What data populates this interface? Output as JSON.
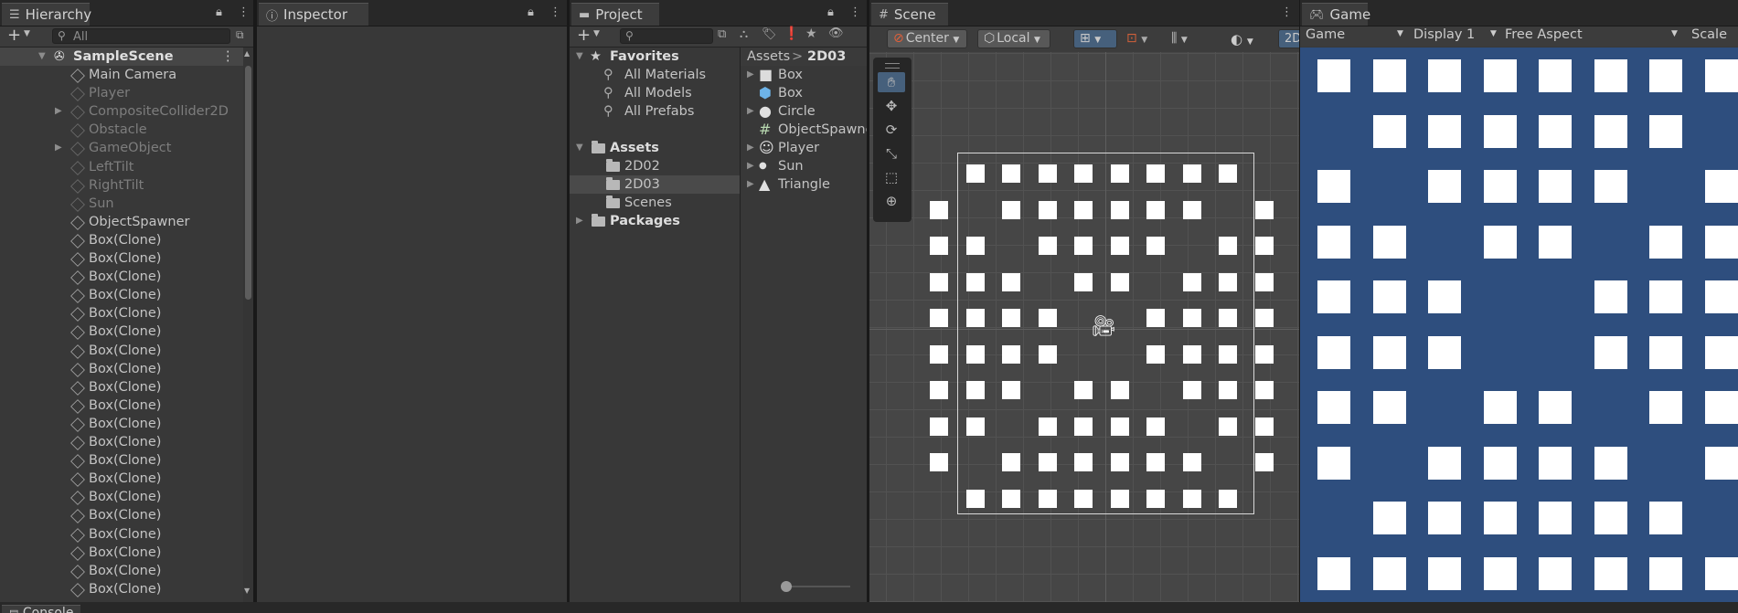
{
  "hierarchy": {
    "tab": "Hierarchy",
    "add": "+",
    "search_placeholder": "All",
    "scene": "SampleScene",
    "items": [
      {
        "label": "Main Camera",
        "dim": false,
        "expand": false
      },
      {
        "label": "Player",
        "dim": true,
        "expand": false
      },
      {
        "label": "CompositeCollider2D",
        "dim": true,
        "expand": true
      },
      {
        "label": "Obstacle",
        "dim": true,
        "expand": false
      },
      {
        "label": "GameObject",
        "dim": true,
        "expand": true
      },
      {
        "label": "LeftTilt",
        "dim": true,
        "expand": false
      },
      {
        "label": "RightTilt",
        "dim": true,
        "expand": false
      },
      {
        "label": "Sun",
        "dim": true,
        "expand": false
      },
      {
        "label": "ObjectSpawner",
        "dim": false,
        "expand": false
      },
      {
        "label": "Box(Clone)",
        "dim": false,
        "expand": false
      },
      {
        "label": "Box(Clone)",
        "dim": false,
        "expand": false
      },
      {
        "label": "Box(Clone)",
        "dim": false,
        "expand": false
      },
      {
        "label": "Box(Clone)",
        "dim": false,
        "expand": false
      },
      {
        "label": "Box(Clone)",
        "dim": false,
        "expand": false
      },
      {
        "label": "Box(Clone)",
        "dim": false,
        "expand": false
      },
      {
        "label": "Box(Clone)",
        "dim": false,
        "expand": false
      },
      {
        "label": "Box(Clone)",
        "dim": false,
        "expand": false
      },
      {
        "label": "Box(Clone)",
        "dim": false,
        "expand": false
      },
      {
        "label": "Box(Clone)",
        "dim": false,
        "expand": false
      },
      {
        "label": "Box(Clone)",
        "dim": false,
        "expand": false
      },
      {
        "label": "Box(Clone)",
        "dim": false,
        "expand": false
      },
      {
        "label": "Box(Clone)",
        "dim": false,
        "expand": false
      },
      {
        "label": "Box(Clone)",
        "dim": false,
        "expand": false
      },
      {
        "label": "Box(Clone)",
        "dim": false,
        "expand": false
      },
      {
        "label": "Box(Clone)",
        "dim": false,
        "expand": false
      },
      {
        "label": "Box(Clone)",
        "dim": false,
        "expand": false
      },
      {
        "label": "Box(Clone)",
        "dim": false,
        "expand": false
      },
      {
        "label": "Box(Clone)",
        "dim": false,
        "expand": false
      },
      {
        "label": "Box(Clone)",
        "dim": false,
        "expand": false
      }
    ]
  },
  "inspector": {
    "tab": "Inspector"
  },
  "project": {
    "tab": "Project",
    "favorites": "Favorites",
    "fav_items": [
      "All Materials",
      "All Models",
      "All Prefabs"
    ],
    "assets": "Assets",
    "asset_folders": [
      "2D02",
      "2D03",
      "Scenes"
    ],
    "packages": "Packages",
    "breadcrumb_root": "Assets",
    "breadcrumb_sep": ">",
    "breadcrumb_current": "2D03",
    "files": [
      {
        "label": "Box",
        "icon": "sprite-square-icon",
        "expand": true
      },
      {
        "label": "Box",
        "icon": "prefab-cube-icon",
        "expand": false
      },
      {
        "label": "Circle",
        "icon": "sprite-circle-icon",
        "expand": true
      },
      {
        "label": "ObjectSpawner",
        "icon": "script-icon",
        "expand": false
      },
      {
        "label": "Player",
        "icon": "sprite-face-icon",
        "expand": true
      },
      {
        "label": "Sun",
        "icon": "sprite-sun-icon",
        "expand": true
      },
      {
        "label": "Triangle",
        "icon": "sprite-triangle-icon",
        "expand": true
      }
    ]
  },
  "scene": {
    "tab": "Scene",
    "pivot": "Center",
    "space": "Local",
    "mode_2d": "2D",
    "boxes": [
      [
        0,
        1,
        1,
        1,
        1,
        1,
        1,
        1,
        1,
        0
      ],
      [
        1,
        0,
        1,
        1,
        1,
        1,
        1,
        1,
        0,
        1
      ],
      [
        1,
        1,
        0,
        1,
        1,
        1,
        1,
        0,
        1,
        1
      ],
      [
        1,
        1,
        1,
        0,
        1,
        1,
        0,
        1,
        1,
        1
      ],
      [
        1,
        1,
        1,
        1,
        0,
        0,
        1,
        1,
        1,
        1
      ],
      [
        1,
        1,
        1,
        1,
        0,
        0,
        1,
        1,
        1,
        1
      ],
      [
        1,
        1,
        1,
        0,
        1,
        1,
        0,
        1,
        1,
        1
      ],
      [
        1,
        1,
        0,
        1,
        1,
        1,
        1,
        0,
        1,
        1
      ],
      [
        1,
        0,
        1,
        1,
        1,
        1,
        1,
        1,
        0,
        1
      ],
      [
        0,
        1,
        1,
        1,
        1,
        1,
        1,
        1,
        1,
        0
      ]
    ]
  },
  "game": {
    "tab": "Game",
    "mode": "Game",
    "display": "Display 1",
    "aspect": "Free Aspect",
    "scale": "Scale",
    "bg_color": "#2e4e7e",
    "boxes": [
      [
        1,
        1,
        1,
        1,
        1,
        1,
        1,
        1
      ],
      [
        0,
        1,
        1,
        1,
        1,
        1,
        1,
        0
      ],
      [
        1,
        0,
        1,
        1,
        1,
        1,
        0,
        1
      ],
      [
        1,
        1,
        0,
        1,
        1,
        0,
        1,
        1
      ],
      [
        1,
        1,
        1,
        0,
        0,
        1,
        1,
        1
      ],
      [
        1,
        1,
        1,
        0,
        0,
        1,
        1,
        1
      ],
      [
        1,
        1,
        0,
        1,
        1,
        0,
        1,
        1
      ],
      [
        1,
        0,
        1,
        1,
        1,
        1,
        0,
        1
      ],
      [
        0,
        1,
        1,
        1,
        1,
        1,
        1,
        0
      ],
      [
        1,
        1,
        1,
        1,
        1,
        1,
        1,
        1
      ]
    ]
  },
  "console": {
    "tab": "Console"
  }
}
